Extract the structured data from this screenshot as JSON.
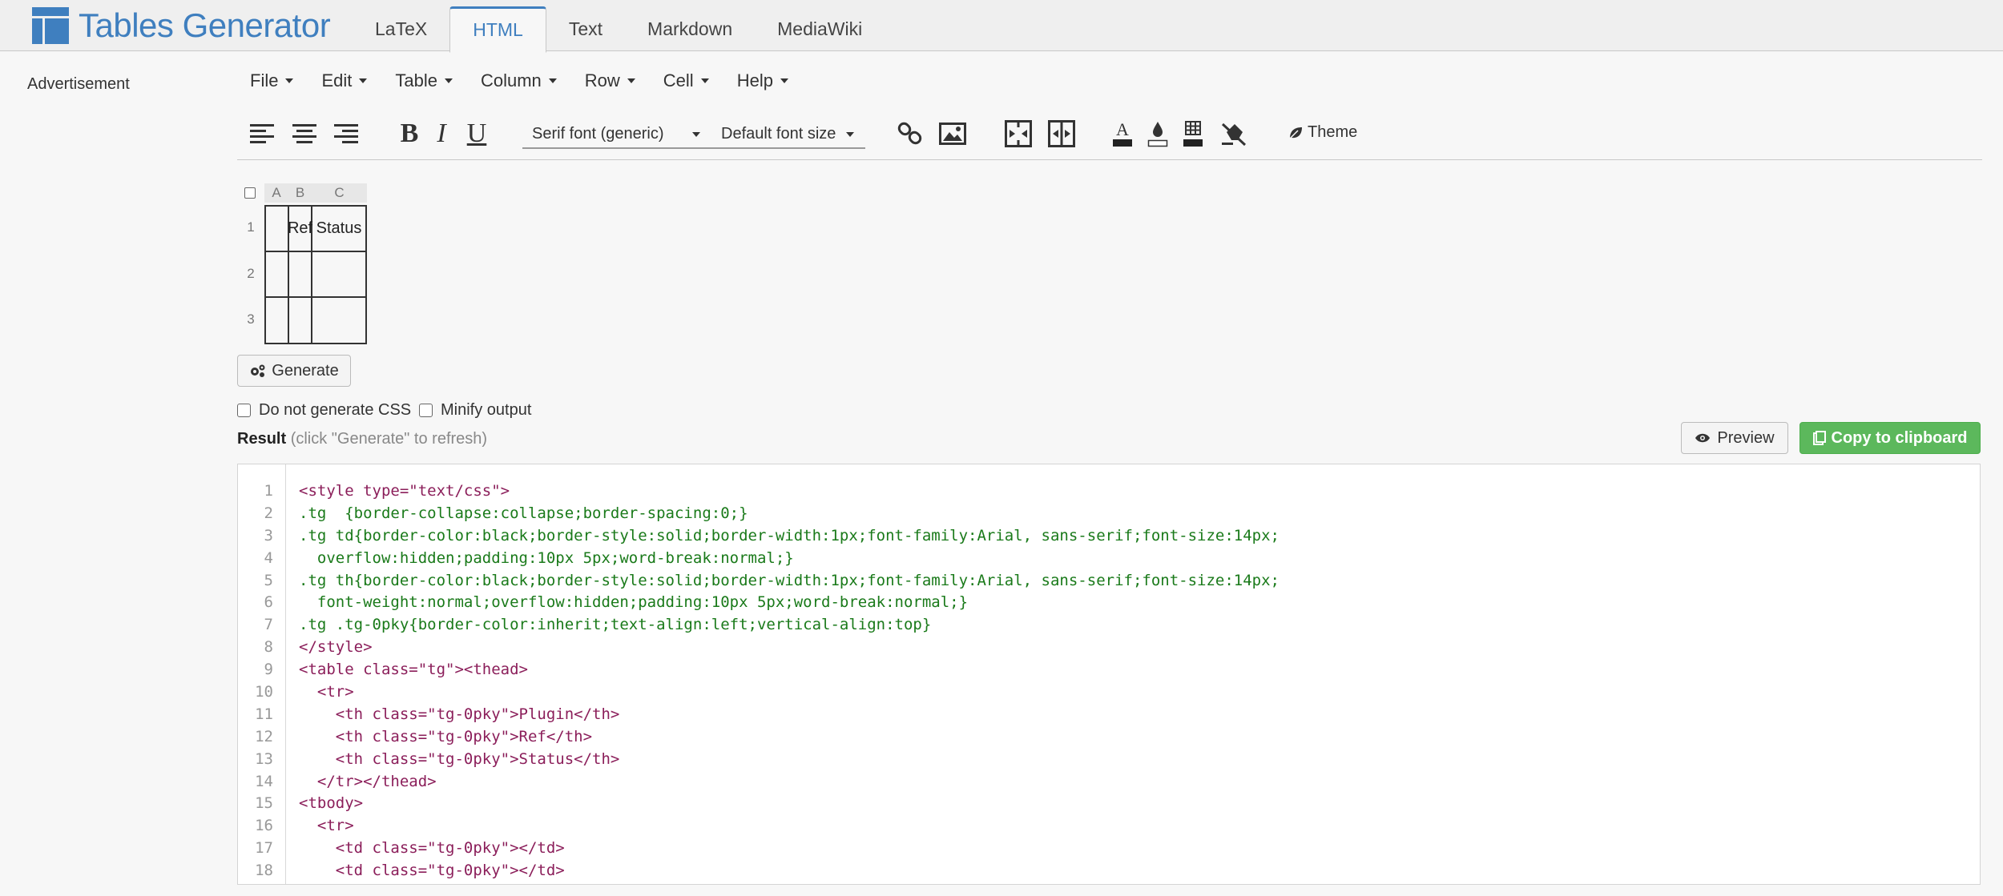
{
  "app": {
    "title": "Tables Generator",
    "brand_color": "#3f7fbf"
  },
  "nav": {
    "tabs": [
      "LaTeX",
      "HTML",
      "Text",
      "Markdown",
      "MediaWiki"
    ],
    "active": "HTML"
  },
  "sidebar": {
    "advertisement": "Advertisement"
  },
  "menus": [
    "File",
    "Edit",
    "Table",
    "Column",
    "Row",
    "Cell",
    "Help"
  ],
  "toolbar": {
    "font_family": "Serif font (generic)",
    "font_size": "Default font size",
    "theme_label": "Theme"
  },
  "grid": {
    "columns": [
      "A",
      "B",
      "C"
    ],
    "rows": [
      "1",
      "2",
      "3"
    ],
    "cells": [
      [
        "",
        "Ref",
        "Status"
      ],
      [
        "",
        "",
        ""
      ],
      [
        "",
        "",
        ""
      ]
    ]
  },
  "actions": {
    "generate": "Generate",
    "no_css": "Do not generate CSS",
    "minify": "Minify output",
    "preview": "Preview",
    "copy": "Copy to clipboard"
  },
  "result": {
    "title": "Result",
    "hint": "(click \"Generate\" to refresh)"
  },
  "code_lines": [
    "1",
    "2",
    "3",
    "4",
    "5",
    "6",
    "7",
    "8",
    "9",
    "10",
    "11",
    "12",
    "13",
    "14",
    "15",
    "16",
    "17",
    "18"
  ],
  "code": {
    "l1": "<style type=\"text/css\">",
    "l2": ".tg  {border-collapse:collapse;border-spacing:0;}",
    "l3": ".tg td{border-color:black;border-style:solid;border-width:1px;font-family:Arial, sans-serif;font-size:14px;",
    "l4": "  overflow:hidden;padding:10px 5px;word-break:normal;}",
    "l5": ".tg th{border-color:black;border-style:solid;border-width:1px;font-family:Arial, sans-serif;font-size:14px;",
    "l6": "  font-weight:normal;overflow:hidden;padding:10px 5px;word-break:normal;}",
    "l7": ".tg .tg-0pky{border-color:inherit;text-align:left;vertical-align:top}",
    "l8": "</style>",
    "l9": "<table class=\"tg\"><thead>",
    "l10": "  <tr>",
    "l11": "    <th class=\"tg-0pky\">Plugin</th>",
    "l12": "    <th class=\"tg-0pky\">Ref</th>",
    "l13": "    <th class=\"tg-0pky\">Status</th>",
    "l14": "  </tr></thead>",
    "l15": "<tbody>",
    "l16": "  <tr>",
    "l17": "    <td class=\"tg-0pky\"></td>",
    "l18": "    <td class=\"tg-0pky\"></td>"
  }
}
